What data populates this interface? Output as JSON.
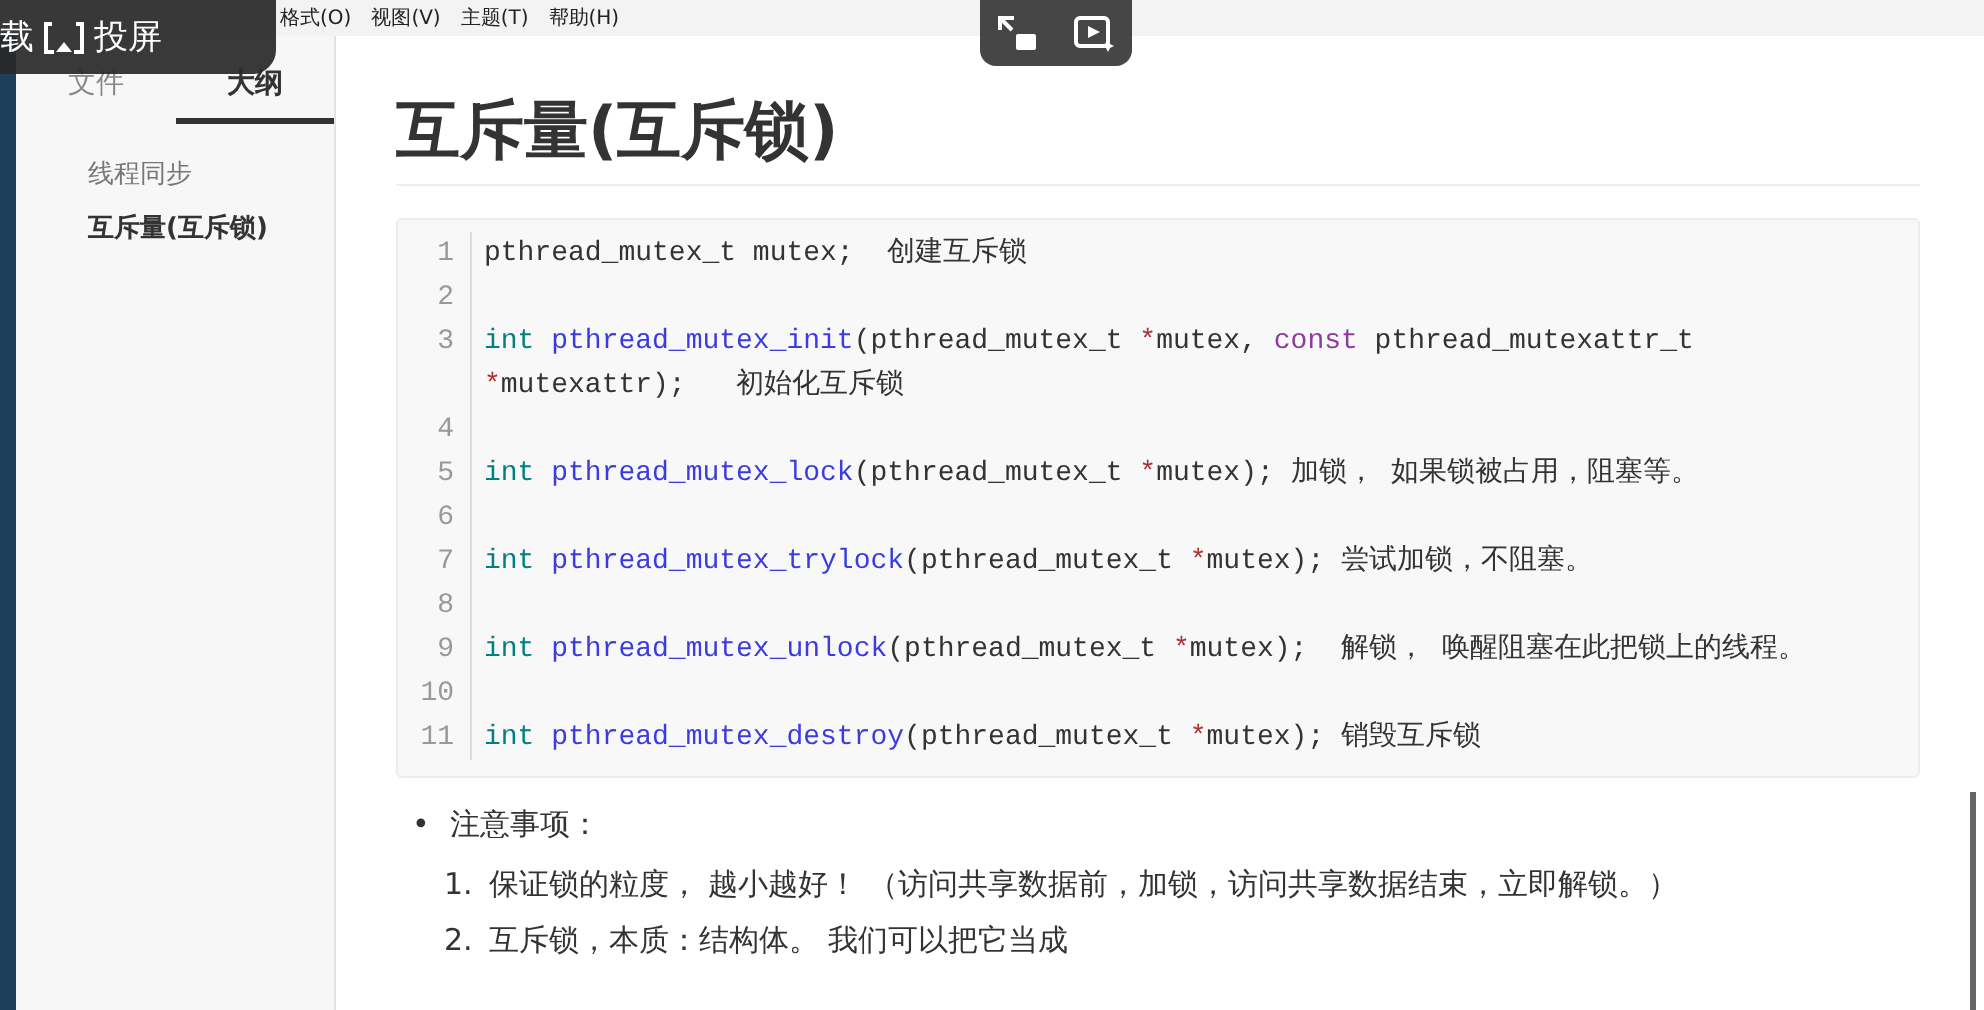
{
  "menu_bar": {
    "items": [
      "格式(O)",
      "视图(V)",
      "主题(T)",
      "帮助(H)"
    ]
  },
  "player_overlay": {
    "labels": [
      "载",
      "投屏"
    ]
  },
  "sidebar": {
    "tabs": [
      {
        "label": "文件",
        "selected": false
      },
      {
        "label": "大纲",
        "selected": true
      }
    ],
    "outline": [
      {
        "label": "线程同步",
        "selected": false
      },
      {
        "label": "互斥量(互斥锁)",
        "selected": true
      }
    ]
  },
  "document": {
    "heading": "互斥量(互斥锁)",
    "code_lines": [
      {
        "number": "1",
        "tokens": [
          {
            "kind": "plain",
            "text": "pthread_mutex_t mutex;  创建互斥锁"
          }
        ]
      },
      {
        "number": "2"
      },
      {
        "number": "3",
        "tokens": [
          {
            "kind": "keyword",
            "text": "int "
          },
          {
            "kind": "function",
            "text": "pthread_mutex_init"
          },
          {
            "kind": "plain",
            "text": "(pthread_mutex_t "
          },
          {
            "kind": "operator",
            "text": "*"
          },
          {
            "kind": "plain",
            "text": "mutex, "
          },
          {
            "kind": "modifier",
            "text": "const"
          },
          {
            "kind": "plain",
            "text": " pthread_mutexattr_t "
          },
          {
            "kind": "operator",
            "text": "*"
          },
          {
            "kind": "plain",
            "text": "mutexattr);   初始化互斥锁"
          }
        ]
      },
      {
        "number": "4"
      },
      {
        "number": "5",
        "tokens": [
          {
            "kind": "keyword",
            "text": "int "
          },
          {
            "kind": "function",
            "text": "pthread_mutex_lock"
          },
          {
            "kind": "plain",
            "text": "(pthread_mutex_t "
          },
          {
            "kind": "operator",
            "text": "*"
          },
          {
            "kind": "plain",
            "text": "mutex); 加锁， 如果锁被占用，阻塞等。"
          }
        ]
      },
      {
        "number": "6"
      },
      {
        "number": "7",
        "tokens": [
          {
            "kind": "keyword",
            "text": "int "
          },
          {
            "kind": "function",
            "text": "pthread_mutex_trylock"
          },
          {
            "kind": "plain",
            "text": "(pthread_mutex_t "
          },
          {
            "kind": "operator",
            "text": "*"
          },
          {
            "kind": "plain",
            "text": "mutex); 尝试加锁，不阻塞。"
          }
        ]
      },
      {
        "number": "8"
      },
      {
        "number": "9",
        "tokens": [
          {
            "kind": "keyword",
            "text": "int "
          },
          {
            "kind": "function",
            "text": "pthread_mutex_unlock"
          },
          {
            "kind": "plain",
            "text": "(pthread_mutex_t "
          },
          {
            "kind": "operator",
            "text": "*"
          },
          {
            "kind": "plain",
            "text": "mutex);  解锁， 唤醒阻塞在此把锁上的线程。"
          }
        ]
      },
      {
        "number": "10"
      },
      {
        "number": "11",
        "tokens": [
          {
            "kind": "keyword",
            "text": "int "
          },
          {
            "kind": "function",
            "text": "pthread_mutex_destroy"
          },
          {
            "kind": "plain",
            "text": "(pthread_mutex_t "
          },
          {
            "kind": "operator",
            "text": "*"
          },
          {
            "kind": "plain",
            "text": "mutex); 销毁互斥锁"
          }
        ]
      }
    ],
    "bullets": [
      {
        "marker": "•",
        "text": "注意事项：",
        "items": [
          {
            "number": "1.",
            "text": "保证锁的粒度， 越小越好！ （访问共享数据前，加锁，访问共享数据结束，立即解锁。）"
          },
          {
            "number": "2.",
            "text": "互斥锁，本质：结构体。 我们可以把它当成"
          }
        ]
      }
    ]
  }
}
